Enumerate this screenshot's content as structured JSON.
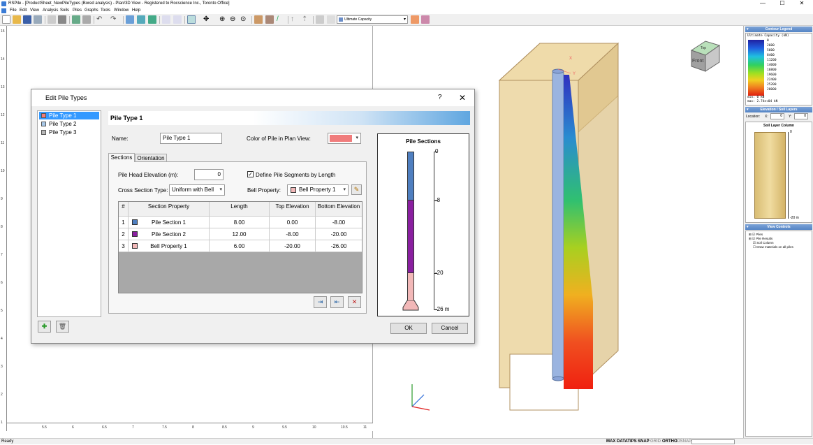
{
  "window": {
    "title": "RSPile - [ProductSheet_NewPileTypes (Bored analysis) - Plan/3D View - Registered to Rocscience Inc., Toronto Office]",
    "minimize": "—",
    "maximize": "☐",
    "close": "✕"
  },
  "menu": [
    "File",
    "Edit",
    "View",
    "Analysis",
    "Soils",
    "Piles",
    "Graphs",
    "Tools",
    "Window",
    "Help"
  ],
  "toolbar": {
    "result_selector": "Ultimate Capacity"
  },
  "plan_view": {
    "vertical_ruler_labels": [
      "15",
      "14",
      "13",
      "12",
      "11",
      "10",
      "9",
      "8",
      "7",
      "6",
      "5",
      "4",
      "3",
      "2",
      "1"
    ],
    "horizontal_ruler_labels": [
      "5.5",
      "6",
      "6.5",
      "7",
      "7.5",
      "8",
      "8.5",
      "9",
      "9.5",
      "10",
      "10.5",
      "11"
    ]
  },
  "dialog": {
    "title": "Edit Pile Types",
    "help": "?",
    "close": "✕",
    "pile_types": [
      {
        "label": "Pile Type 1",
        "color": "#f07c7c",
        "selected": true
      },
      {
        "label": "Pile Type 2",
        "color": "#a8c8e8",
        "selected": false
      },
      {
        "label": "Pile Type 3",
        "color": "#b8b8b8",
        "selected": false
      }
    ],
    "header": "Pile Type 1",
    "name_label": "Name:",
    "name_value": "Pile Type 1",
    "color_label": "Color of Pile in Plan View:",
    "plan_color": "#f07c7c",
    "tabs": [
      "Sections",
      "Orientation"
    ],
    "active_tab": "Sections",
    "head_elev_label": "Pile Head Elevation (m):",
    "head_elev_value": "0",
    "define_segments_label": "Define Pile Segments by Length",
    "define_segments_checked": true,
    "cross_section_label": "Cross Section Type:",
    "cross_section_value": "Uniform with Bell",
    "bell_label": "Bell Property:",
    "bell_value": "Bell Property 1",
    "table": {
      "headers": [
        "#",
        "Section Property",
        "Length",
        "Top Elevation",
        "Bottom Elevation"
      ],
      "rows": [
        {
          "num": "1",
          "color": "#4f7fc0",
          "property": "Pile Section 1",
          "length": "8.00",
          "top": "0.00",
          "bottom": "-8.00"
        },
        {
          "num": "2",
          "color": "#8a1fa0",
          "property": "Pile Section 2",
          "length": "12.00",
          "top": "-8.00",
          "bottom": "-20.00"
        },
        {
          "num": "3",
          "color": "#f2b8b8",
          "property": "Bell Property 1",
          "length": "6.00",
          "top": "-20.00",
          "bottom": "-26.00"
        }
      ]
    },
    "pile_sections": {
      "title": "Pile Sections",
      "ticks": [
        "0",
        "-8",
        "-20",
        "-26 m"
      ]
    },
    "ok": "OK",
    "cancel": "Cancel"
  },
  "right_panel": {
    "contour_legend_title": "Contour Legend",
    "contour_legend_subtitle": "Ultimate Capacity (kN)",
    "legend_values": [
      "0",
      "2600",
      "5600",
      "8400",
      "11200",
      "14000",
      "16800",
      "19600",
      "22400",
      "25200",
      "28000"
    ],
    "legend_min": "min: 0 kN",
    "legend_max": "max: 2.74e+04 kN",
    "elevation_title": "Elevation / Soil Layers",
    "location_label": "Location:",
    "x_label": "X:",
    "x_value": "0",
    "y_label": "Y:",
    "y_value": "0",
    "soil_column_title": "Soil Layer Column",
    "soil_top": "0",
    "soil_bottom": "-20 m",
    "view_controls_title": "View Controls",
    "tree": [
      "Piles",
      "Pile Results",
      "Soil Column",
      "Draw materials on all piles"
    ]
  },
  "view3d": {
    "cube_face": "Front",
    "cube_top": "Top"
  },
  "status": {
    "left": "Ready",
    "items": [
      "MAX DATATIPS",
      "SNAP",
      "GRID",
      "ORTHO",
      "OSNAP"
    ]
  }
}
